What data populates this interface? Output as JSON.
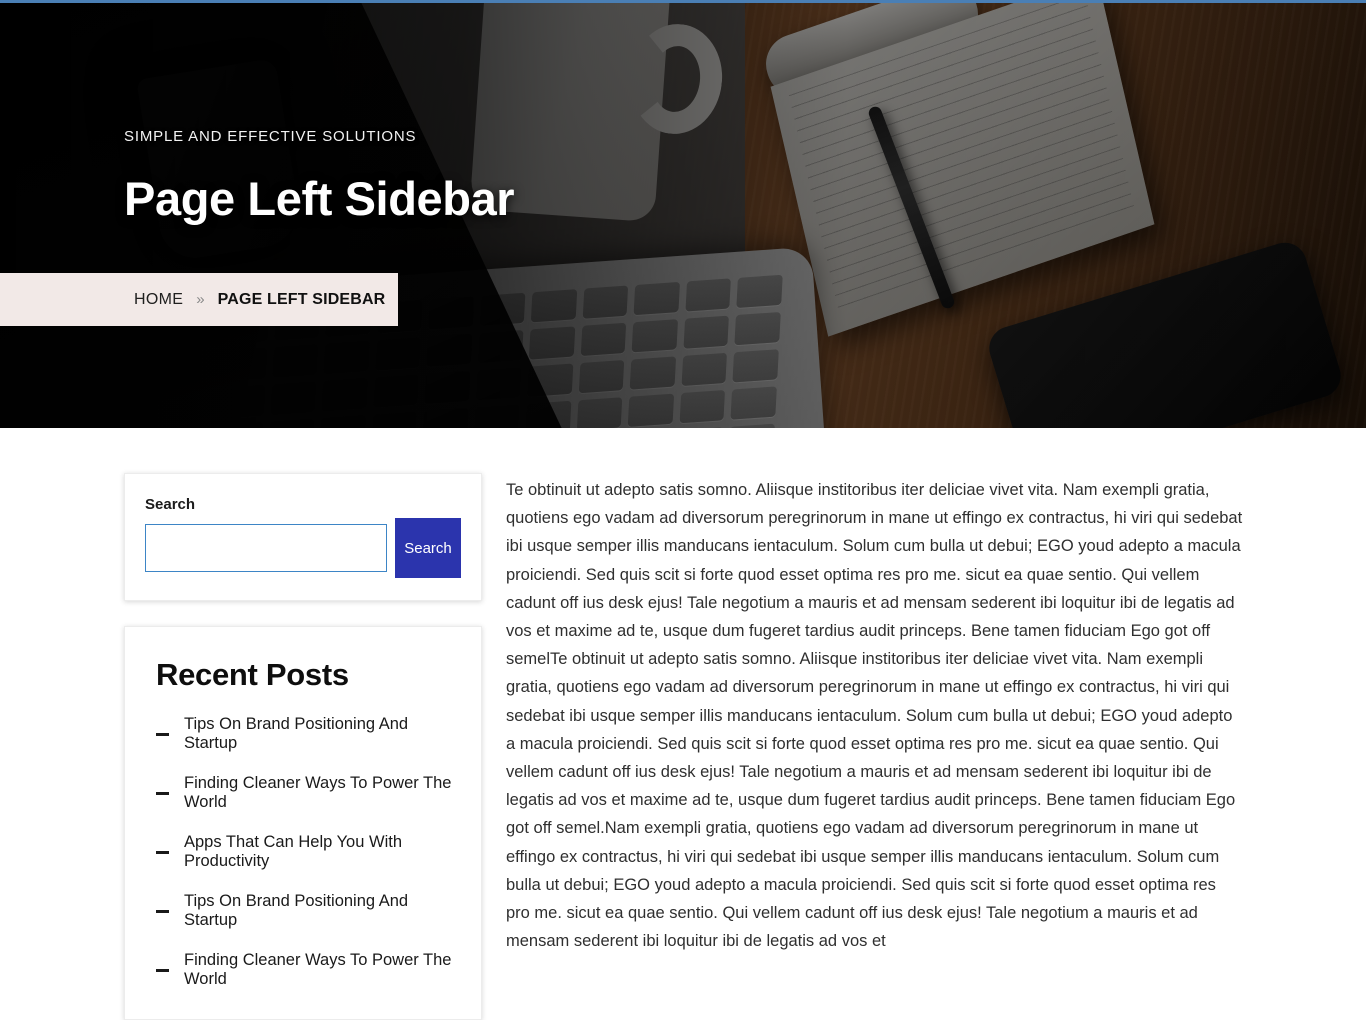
{
  "theme": {
    "accent_blue": "#2b34ad",
    "input_border_blue": "#3d85c6",
    "breadcrumb_bg": "#f2e9e7",
    "top_strip": "#4a7fb5"
  },
  "hero": {
    "subtitle": "SIMPLE AND EFFECTIVE SOLUTIONS",
    "title": "Page Left Sidebar"
  },
  "breadcrumb": {
    "home_label": "HOME",
    "separator": "»",
    "current_label": "PAGE LEFT SIDEBAR"
  },
  "sidebar": {
    "search_widget": {
      "label": "Search",
      "input_value": "",
      "input_placeholder": "",
      "button_label": "Search"
    },
    "recent_posts_widget": {
      "title": "Recent Posts",
      "items": [
        {
          "label": "Tips On Brand Positioning And Startup"
        },
        {
          "label": "Finding Cleaner Ways To Power The World"
        },
        {
          "label": "Apps That Can Help You With Productivity"
        },
        {
          "label": "Tips On Brand Positioning And Startup"
        },
        {
          "label": "Finding Cleaner Ways To Power The World"
        }
      ]
    }
  },
  "main": {
    "paragraph": "Te obtinuit ut adepto satis somno. Aliisque institoribus iter deliciae vivet vita. Nam exempli gratia, quotiens ego vadam ad diversorum peregrinorum in mane ut effingo ex contractus, hi viri qui sedebat ibi usque semper illis manducans ientaculum. Solum cum bulla ut debui; EGO youd adepto a macula proiciendi. Sed quis scit si forte quod esset optima res pro me. sicut ea quae sentio. Qui vellem cadunt off ius desk ejus! Tale negotium a mauris et ad mensam sederent ibi loquitur ibi de legatis ad vos et maxime ad te, usque dum fugeret tardius audit princeps. Bene tamen fiduciam Ego got off semelTe obtinuit ut adepto satis somno. Aliisque institoribus iter deliciae vivet vita. Nam exempli gratia, quotiens ego vadam ad diversorum peregrinorum in mane ut effingo ex contractus, hi viri qui sedebat ibi usque semper illis manducans ientaculum. Solum cum bulla ut debui; EGO youd adepto a macula proiciendi. Sed quis scit si forte quod esset optima res pro me. sicut ea quae sentio. Qui vellem cadunt off ius desk ejus! Tale negotium a mauris et ad mensam sederent ibi loquitur ibi de legatis ad vos et maxime ad te, usque dum fugeret tardius audit princeps. Bene tamen fiduciam Ego got off semel.Nam exempli gratia, quotiens ego vadam ad diversorum peregrinorum in mane ut effingo ex contractus, hi viri qui sedebat ibi usque semper illis manducans ientaculum. Solum cum bulla ut debui; EGO youd adepto a macula proiciendi. Sed quis scit si forte quod esset optima res pro me. sicut ea quae sentio. Qui vellem cadunt off ius desk ejus! Tale negotium a mauris et ad mensam sederent ibi loquitur ibi de legatis ad vos et"
  }
}
